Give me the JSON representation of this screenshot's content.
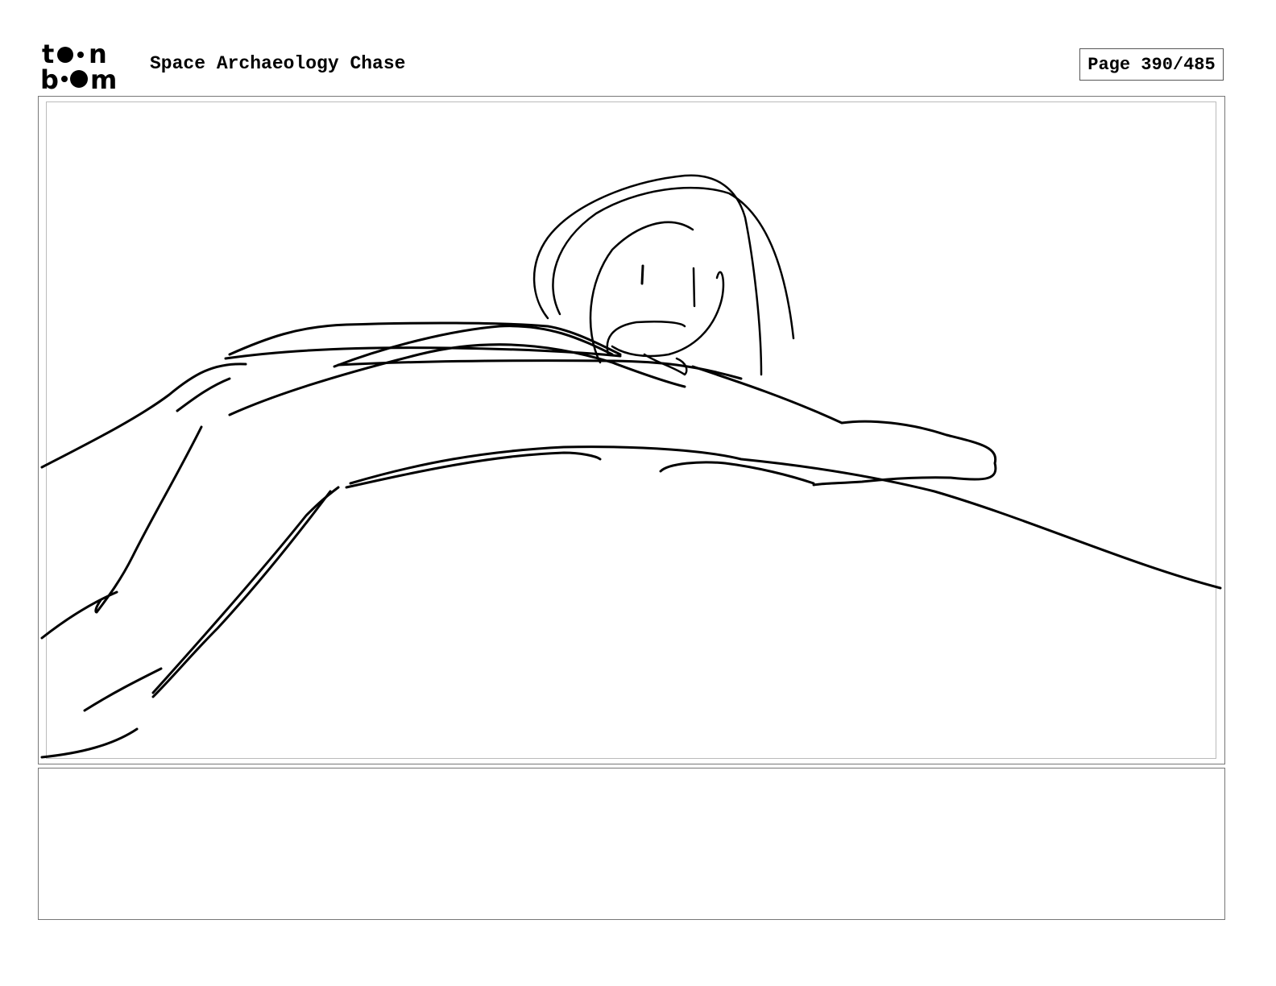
{
  "header": {
    "logo_top": "t",
    "logo_bottom": "b",
    "logo_top_end": "n",
    "logo_bottom_end": "m",
    "logo_alt": "toon boom",
    "project_title": "Space Archaeology Chase",
    "page_label": "Page 390/485"
  },
  "panel": {
    "image_icon": "storyboard-sketch",
    "line_color": "#000000",
    "frame_color": "#777777"
  },
  "notes": {
    "text": ""
  }
}
